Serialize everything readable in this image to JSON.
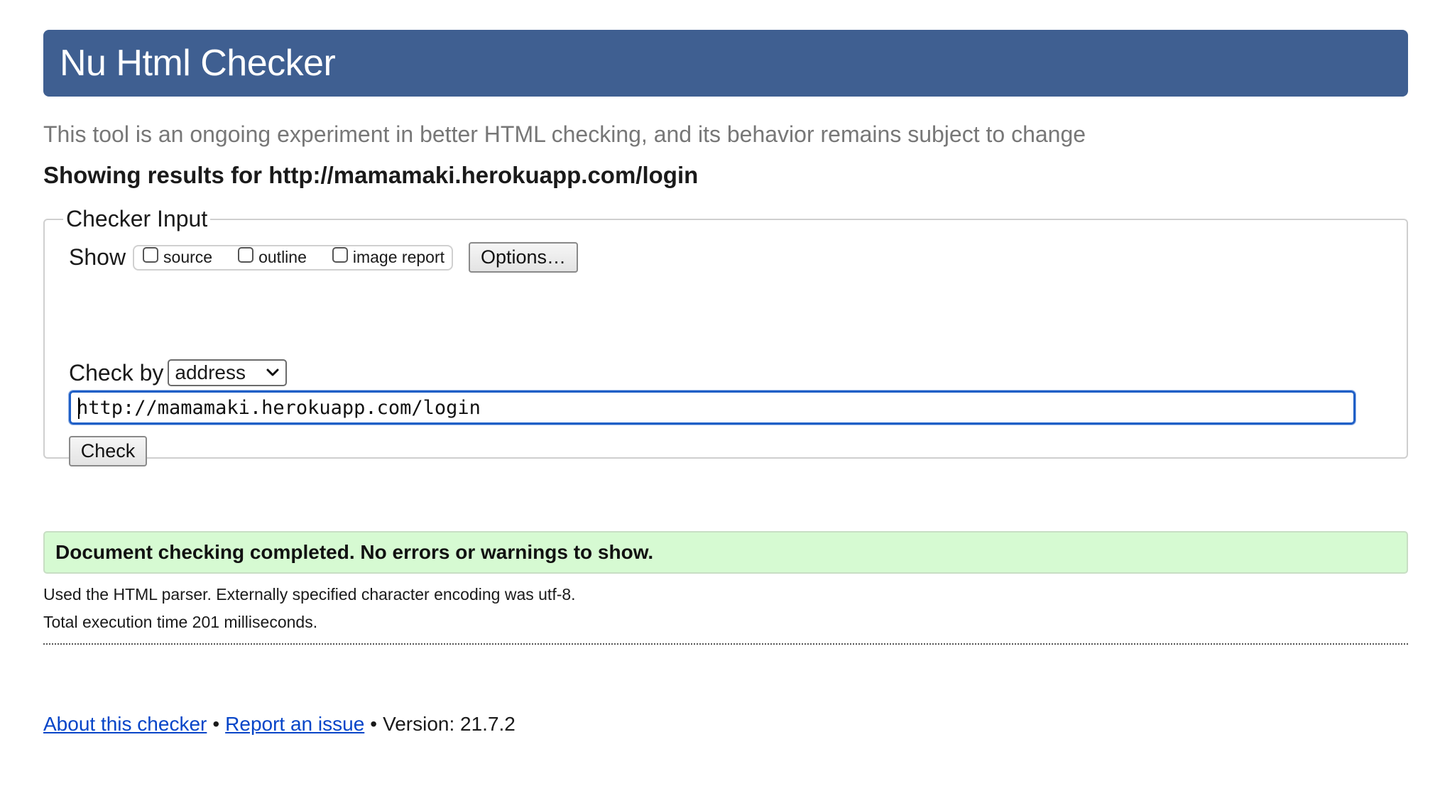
{
  "header": {
    "title": "Nu Html Checker",
    "color": "#3f5f91"
  },
  "tagline": "This tool is an ongoing experiment in better HTML checking, and its behavior remains subject to change",
  "results_for": "Showing results for http://mamamaki.herokuapp.com/login",
  "checker_input": {
    "legend": "Checker Input",
    "show_label": "Show",
    "show_options": [
      {
        "label": "source",
        "checked": false
      },
      {
        "label": "outline",
        "checked": false
      },
      {
        "label": "image report",
        "checked": false
      }
    ],
    "options_button": "Options…",
    "check_by_label": "Check by",
    "check_by_selected": "address",
    "url_value": "http://mamamaki.herokuapp.com/login",
    "check_button": "Check"
  },
  "result": {
    "message": "Document checking completed. No errors or warnings to show.",
    "color": "#d6fad2",
    "parser_info": "Used the HTML parser. Externally specified character encoding was utf-8.",
    "execution_time": "Total execution time 201 milliseconds."
  },
  "footer": {
    "about_link": "About this checker",
    "separator": "•",
    "report_link": "Report an issue",
    "version": "Version: 21.7.2",
    "link_color": "#0645c8"
  }
}
